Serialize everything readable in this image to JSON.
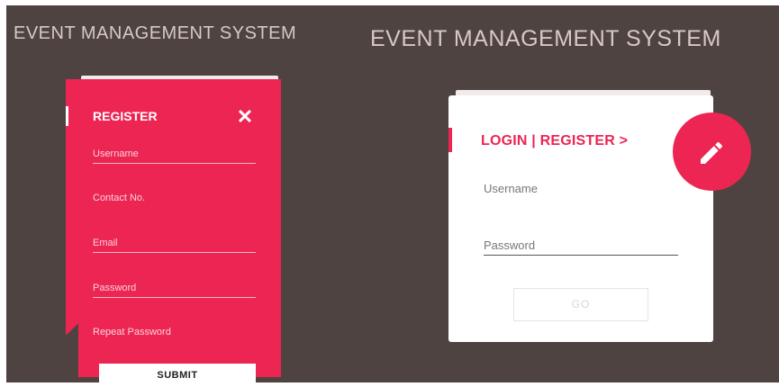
{
  "app_title_small": "EVENT MANAGEMENT SYSTEM",
  "app_title_large": "EVENT MANAGEMENT SYSTEM",
  "register_panel": {
    "heading": "REGISTER",
    "close_icon": "close-icon",
    "fields": [
      {
        "placeholder": "Username"
      },
      {
        "placeholder": "Contact No."
      },
      {
        "placeholder": "Email"
      },
      {
        "placeholder": "Password"
      },
      {
        "placeholder": "Repeat Password"
      }
    ],
    "submit_label": "SUBMIT"
  },
  "login_panel": {
    "heading": "LOGIN | REGISTER >",
    "edit_icon": "pencil-icon",
    "fields": [
      {
        "placeholder": "Username"
      },
      {
        "placeholder": "Password"
      }
    ],
    "go_label": "GO"
  },
  "colors": {
    "background": "#4f4341",
    "accent": "#ed2553",
    "card": "#ffffff"
  }
}
